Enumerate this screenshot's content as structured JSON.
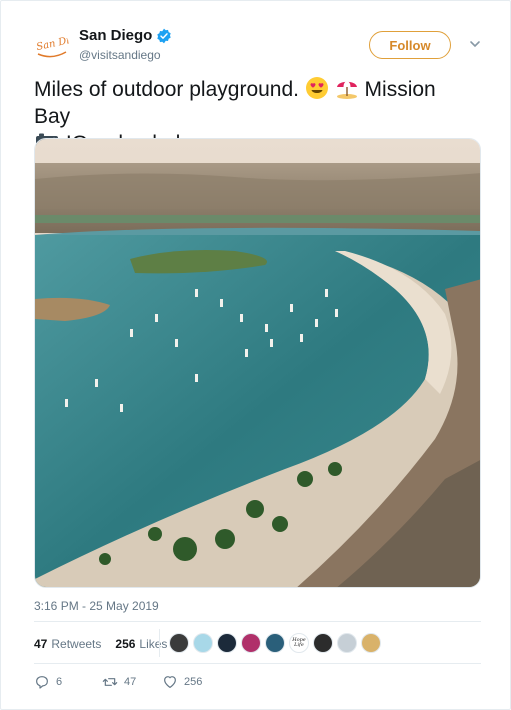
{
  "account": {
    "name": "San Diego",
    "handle": "@visitsandiego",
    "logo_text": "San Diego",
    "verified": true,
    "brand_color": "#e07a2a"
  },
  "follow_label": "Follow",
  "tweet": {
    "text_part1": "Miles of outdoor playground.",
    "text_part2": "Mission Bay",
    "text_part3": "IG: adamhahn",
    "emojis": [
      "heart-eyes-face",
      "beach-umbrella",
      "camera"
    ]
  },
  "photo": {
    "icon": "aerial-photo-mission-bay"
  },
  "timestamp": "3:16 PM - 25 May 2019",
  "stats": {
    "retweets_count": "47",
    "retweets_label": "Retweets",
    "likes_count": "256",
    "likes_label": "Likes"
  },
  "likers": [
    {
      "color": "#3b3b3b"
    },
    {
      "color": "#a8d8e8"
    },
    {
      "color": "#1c2a3a"
    },
    {
      "color": "#b0306a"
    },
    {
      "color": "#2a5f7a"
    },
    {
      "color": "#ffffff",
      "text": "Hope Life"
    },
    {
      "color": "#2c2c2c"
    },
    {
      "color": "#c6cfd6"
    },
    {
      "color": "#d9b26a"
    }
  ],
  "actions": {
    "reply_count": "6",
    "retweet_count": "47",
    "like_count": "256"
  }
}
